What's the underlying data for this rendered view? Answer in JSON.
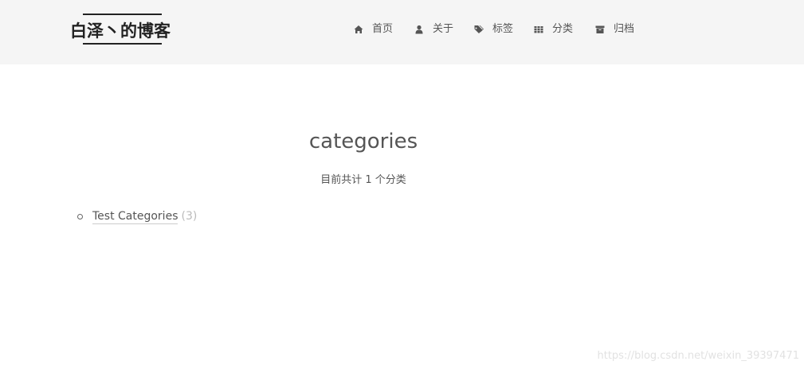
{
  "header": {
    "brand_title": "白泽丶的博客"
  },
  "nav": {
    "items": [
      {
        "icon": "home-icon",
        "label": "首页"
      },
      {
        "icon": "user-icon",
        "label": "关于"
      },
      {
        "icon": "tags-icon",
        "label": "标签"
      },
      {
        "icon": "grid-icon",
        "label": "分类"
      },
      {
        "icon": "archive-icon",
        "label": "归档"
      }
    ]
  },
  "main": {
    "title": "categories",
    "summary_prefix": "目前共计 ",
    "summary_count": "1",
    "summary_suffix": " 个分类",
    "categories": [
      {
        "name": "Test Categories",
        "count": "(3)"
      }
    ]
  },
  "watermark": "https://blog.csdn.net/weixin_39397471"
}
